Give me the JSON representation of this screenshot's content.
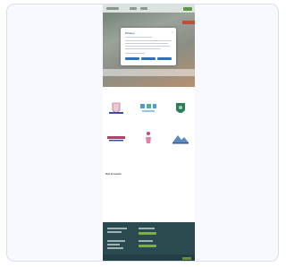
{
  "modal": {
    "title": "Privacy",
    "close": "×",
    "buttons": [
      "",
      "",
      ""
    ]
  },
  "contact": {
    "heading": "Get in touch",
    "subtitle": ""
  },
  "logos": [
    {
      "icon": "school-crest-icon",
      "caption": ""
    },
    {
      "icon": "letters-logo-icon",
      "caption": ""
    },
    {
      "icon": "shield-logo-icon",
      "caption": ""
    },
    {
      "icon": "banner-logo-icon",
      "caption": ""
    },
    {
      "icon": "figure-logo-icon",
      "caption": ""
    },
    {
      "icon": "landscape-logo-icon",
      "caption": ""
    }
  ],
  "colors": {
    "card_bg": "#f7f9fd",
    "card_border": "#d6e0ef",
    "footer_bg": "#2a4a50",
    "modal_button": "#2f71b8",
    "footer_accent": "#7fb03a"
  }
}
